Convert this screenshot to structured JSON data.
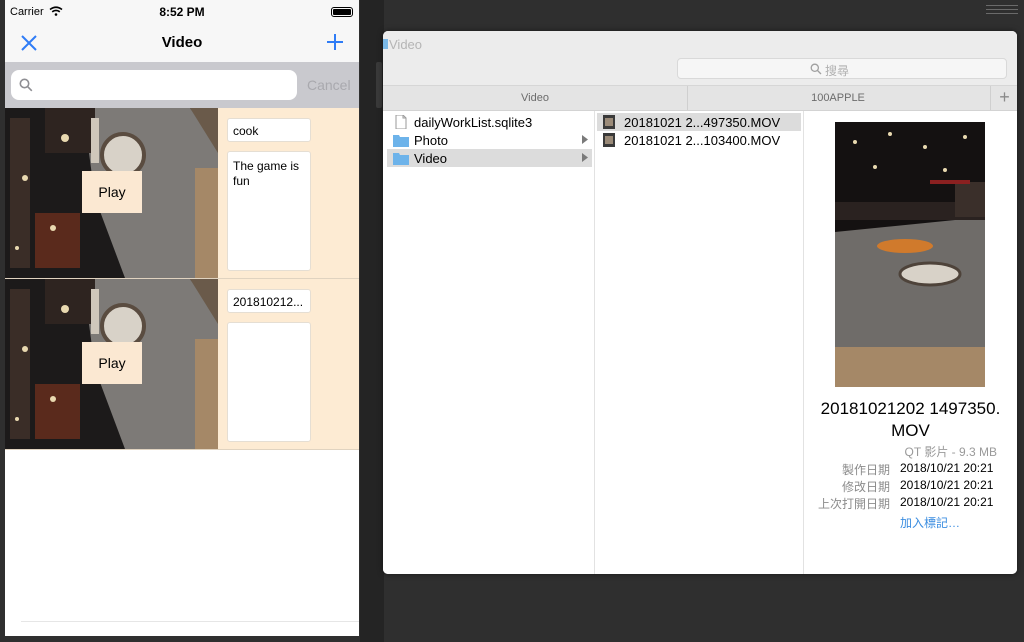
{
  "phone": {
    "status": {
      "carrier": "Carrier",
      "time": "8:52 PM"
    },
    "nav": {
      "title": "Video"
    },
    "search": {
      "placeholder": "",
      "cancel": "Cancel"
    },
    "rows": [
      {
        "play_label": "Play",
        "title": "cook",
        "description": "The game is fun"
      },
      {
        "play_label": "Play",
        "title": "201810212...",
        "description": ""
      }
    ]
  },
  "finder": {
    "window_title": "Video",
    "search_placeholder": "搜尋",
    "tabs": [
      "Video",
      "100APPLE"
    ],
    "column1": [
      {
        "name": "dailyWorkList.sqlite3",
        "kind": "file"
      },
      {
        "name": "Photo",
        "kind": "folder"
      },
      {
        "name": "Video",
        "kind": "folder",
        "selected": true
      }
    ],
    "column2": [
      {
        "name": "20181021 2...497350.MOV",
        "selected": true
      },
      {
        "name": "20181021 2...103400.MOV"
      }
    ],
    "preview": {
      "name_line1": "20181021202 1497350.",
      "name_line2": "MOV",
      "kind": "QT 影片 - 9.3 MB",
      "meta": [
        {
          "key": "製作日期",
          "value": "2018/10/21 20:21"
        },
        {
          "key": "修改日期",
          "value": "2018/10/21 20:21"
        },
        {
          "key": "上次打開日期",
          "value": "2018/10/21 20:21"
        }
      ],
      "add_tags": "加入標記…"
    }
  },
  "colors": {
    "row_bg": "#fdebd3",
    "accent": "#2f7cf6",
    "selection": "#dcdcdc",
    "folder": "#6db3ea"
  }
}
